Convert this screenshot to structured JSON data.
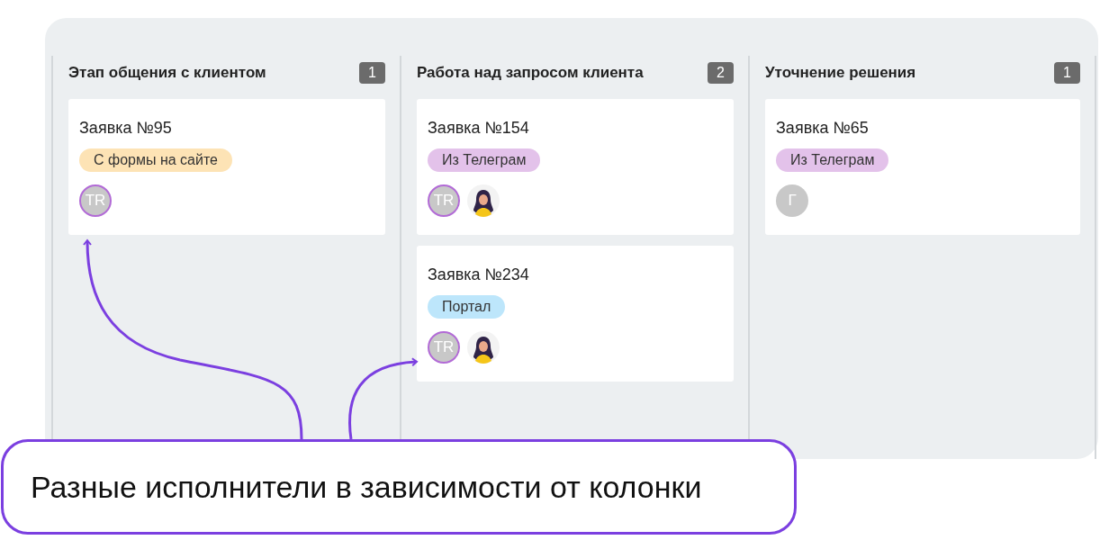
{
  "columns": [
    {
      "title": "Этап общения с клиентом",
      "count": "1",
      "cards": [
        {
          "title": "Заявка №95",
          "tag": {
            "label": "С формы на сайте",
            "color": "#fde3b5"
          },
          "assignees": [
            {
              "kind": "initials",
              "initials": "TR",
              "highlighted": true
            }
          ]
        }
      ]
    },
    {
      "title": "Работа над запросом клиента",
      "count": "2",
      "cards": [
        {
          "title": "Заявка №154",
          "tag": {
            "label": "Из Телеграм",
            "color": "#e3c2ea"
          },
          "assignees": [
            {
              "kind": "initials",
              "initials": "TR",
              "highlighted": true
            },
            {
              "kind": "photo"
            }
          ]
        },
        {
          "title": "Заявка №234",
          "tag": {
            "label": "Портал",
            "color": "#bde6fb"
          },
          "assignees": [
            {
              "kind": "initials",
              "initials": "TR",
              "highlighted": true
            },
            {
              "kind": "photo"
            }
          ]
        }
      ]
    },
    {
      "title": "Уточнение решения",
      "count": "1",
      "cards": [
        {
          "title": "Заявка №65",
          "tag": {
            "label": "Из Телеграм",
            "color": "#e3c2ea"
          },
          "assignees": [
            {
              "kind": "initials",
              "initials": "Г",
              "highlighted": false
            }
          ]
        }
      ]
    }
  ],
  "callout": {
    "text": "Разные исполнители в зависимости от колонки"
  }
}
